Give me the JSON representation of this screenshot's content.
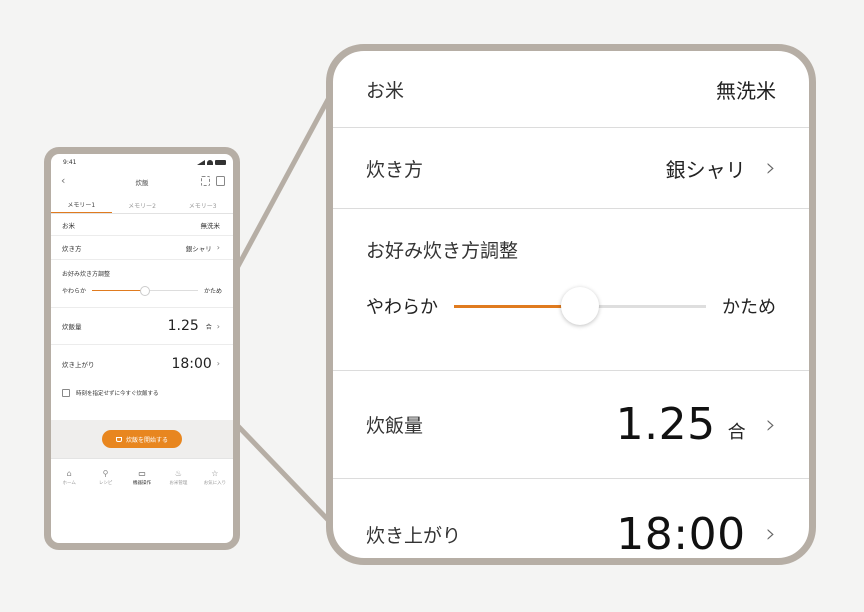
{
  "phone": {
    "status_time": "9:41",
    "header_title": "炊飯",
    "tabs": [
      {
        "label": "メモリー1",
        "active": true
      },
      {
        "label": "メモリー2",
        "active": false
      },
      {
        "label": "メモリー3",
        "active": false
      }
    ],
    "rice": {
      "label": "お米",
      "value": "無洗米"
    },
    "method": {
      "label": "炊き方",
      "value": "銀シャリ"
    },
    "adjust": {
      "label": "お好み炊き方調整",
      "min_label": "やわらか",
      "max_label": "かため",
      "level": 0.5
    },
    "amount": {
      "label": "炊飯量",
      "value": "1.25",
      "unit": "合"
    },
    "finish": {
      "label": "炊き上がり",
      "value": "18:00"
    },
    "checkbox_label": "時刻を指定せずに今すぐ炊飯する",
    "start_button": "炊飯を開始する",
    "nav": [
      {
        "label": "ホーム",
        "icon": "home-icon",
        "glyph": "⌂"
      },
      {
        "label": "レシピ",
        "icon": "search-icon",
        "glyph": "⚲"
      },
      {
        "label": "機器操作",
        "icon": "device-icon",
        "glyph": "▭",
        "active": true
      },
      {
        "label": "お米管理",
        "icon": "rice-icon",
        "glyph": "♨"
      },
      {
        "label": "お気に入り",
        "icon": "star-icon",
        "glyph": "☆"
      }
    ]
  },
  "zoom": {
    "rice": {
      "label": "お米",
      "value": "無洗米"
    },
    "method": {
      "label": "炊き方",
      "value": "銀シャリ"
    },
    "adjust": {
      "label": "お好み炊き方調整",
      "min_label": "やわらか",
      "max_label": "かため",
      "level": 0.5
    },
    "amount": {
      "label": "炊飯量",
      "value": "1.25",
      "unit": "合"
    },
    "finish": {
      "label": "炊き上がり",
      "value": "18:00"
    }
  },
  "colors": {
    "accent": "#e07b1f",
    "frame": "#b6aea5",
    "background": "#f4f4f3"
  }
}
